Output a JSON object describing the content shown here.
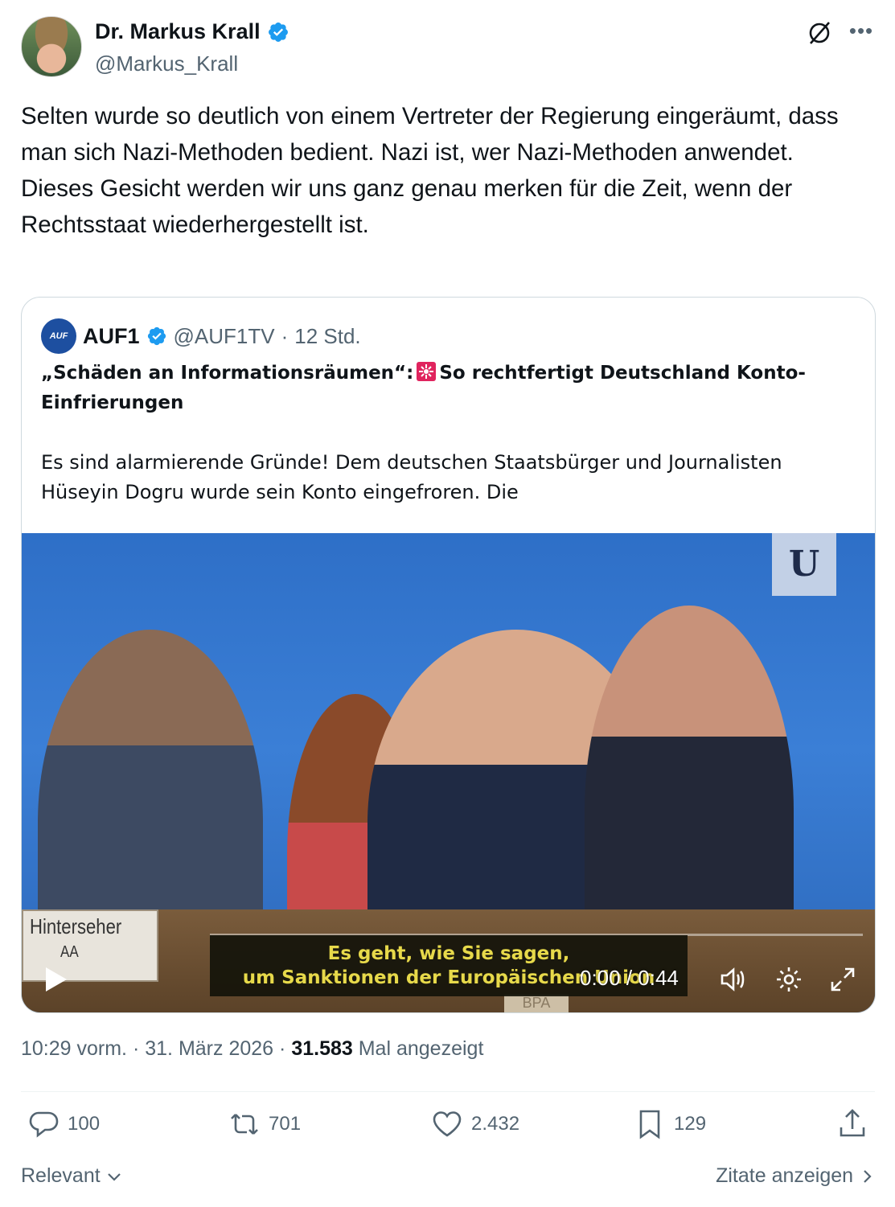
{
  "author": {
    "display_name": "Dr. Markus Krall",
    "handle": "@Markus_Krall"
  },
  "post": {
    "text": "Selten wurde so deutlich von einem Vertreter der Regierung eingeräumt, dass man sich Nazi-Methoden bedient. Nazi ist, wer Nazi-Methoden anwendet.\nDieses Gesicht werden wir uns ganz genau merken für die Zeit, wenn der Rechtsstaat wiederhergestellt ist."
  },
  "quote": {
    "avatar_text": "AUF",
    "display_name": "AUF1",
    "handle": "@AUF1TV",
    "separator": "·",
    "time": "12 Std.",
    "title_part1": "„Schäden an Informationsräumen“:",
    "title_part2": "So rechtfertigt Deutschland Konto-Einfrierungen",
    "body": "Es sind alarmierende Gründe! Dem deutschen Staatsbürger und Journalisten Hüseyin Dogru wurde sein Konto eingefroren. Die",
    "video": {
      "subtitle_line1": "Es geht, wie Sie sagen,",
      "subtitle_line2": "um Sanktionen der Europäischen Union",
      "time": "0:00 / 0:44",
      "nameplate": "Hinterseher",
      "nameplate_sub": "AA",
      "desk_label": "BPA",
      "logo": "U",
      "progress": 0
    }
  },
  "meta": {
    "time": "10:29 vorm.",
    "sep1": "·",
    "date": "31. März 2026",
    "sep2": "·",
    "views": "31.583",
    "views_label": "Mal angezeigt"
  },
  "actions": {
    "replies": "100",
    "reposts": "701",
    "likes": "2.432",
    "bookmarks": "129"
  },
  "footer": {
    "sort_label": "Relevant",
    "quotes_link": "Zitate anzeigen"
  },
  "colors": {
    "verified": "#1d9bf0",
    "text": "#0f1419",
    "secondary": "#536471",
    "subtitle": "#e7d94a"
  }
}
